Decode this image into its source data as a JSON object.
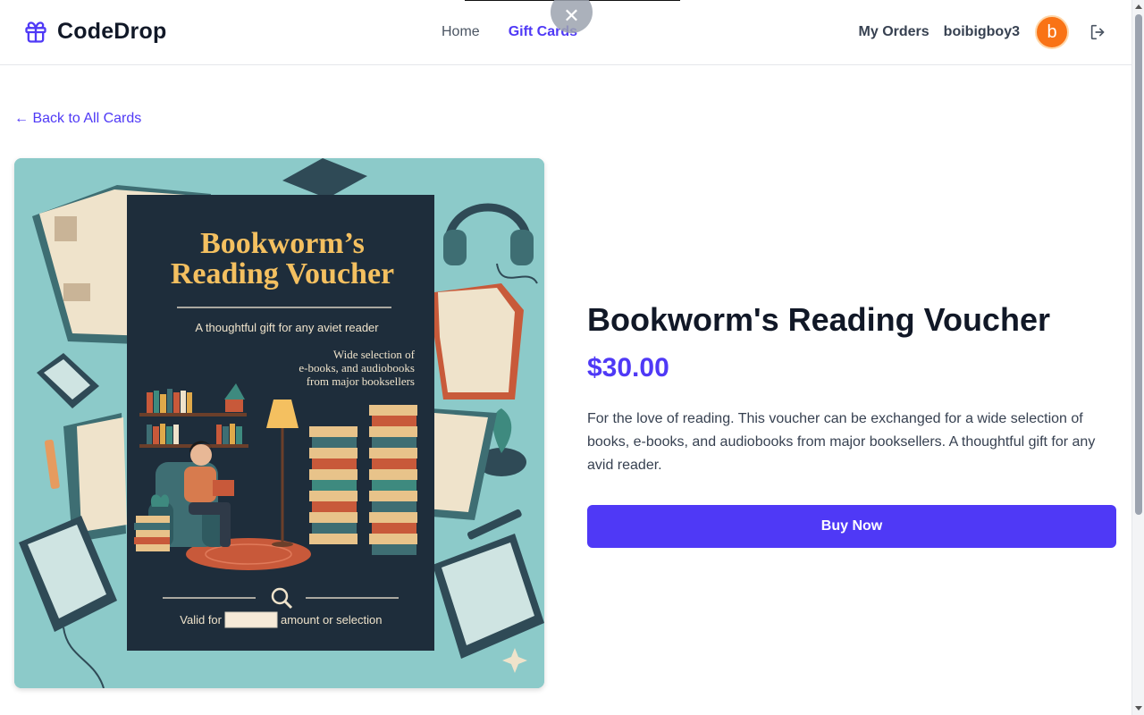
{
  "header": {
    "brand": "CodeDrop",
    "nav": [
      {
        "label": "Home",
        "active": false
      },
      {
        "label": "Gift Cards",
        "active": true
      }
    ],
    "orders_label": "My Orders",
    "username": "boibigboy3",
    "avatar_letter": "b"
  },
  "overlay": {
    "close_glyph": "✕"
  },
  "back_link": "← Back to All Cards",
  "product": {
    "title": "Bookworm's Reading Voucher",
    "price": "$30.00",
    "description": "For the love of reading. This voucher can be exchanged for a wide selection of books, e-books, and audiobooks from major booksellers. A thoughtful gift for any avid reader.",
    "buy_label": "Buy Now"
  },
  "voucher_image": {
    "title_line1": "Bookworm’s",
    "title_line2": "Reading Voucher",
    "subtitle": "A thoughtful gift for any aviet reader",
    "blurb_line1": "Wide selection of",
    "blurb_line2": "e-books, and audiobooks",
    "blurb_line3": "from major booksellers",
    "valid_prefix": "Valid for",
    "valid_suffix": "amount or selection"
  },
  "colors": {
    "accent": "#4f39f6",
    "avatar": "#f97316",
    "voucher_bg": "#8ccac9",
    "voucher_card": "#1e2d3b",
    "voucher_title": "#f4c060"
  },
  "icons": {
    "brand": "gift-icon",
    "logout": "logout-icon",
    "close": "close-icon"
  }
}
